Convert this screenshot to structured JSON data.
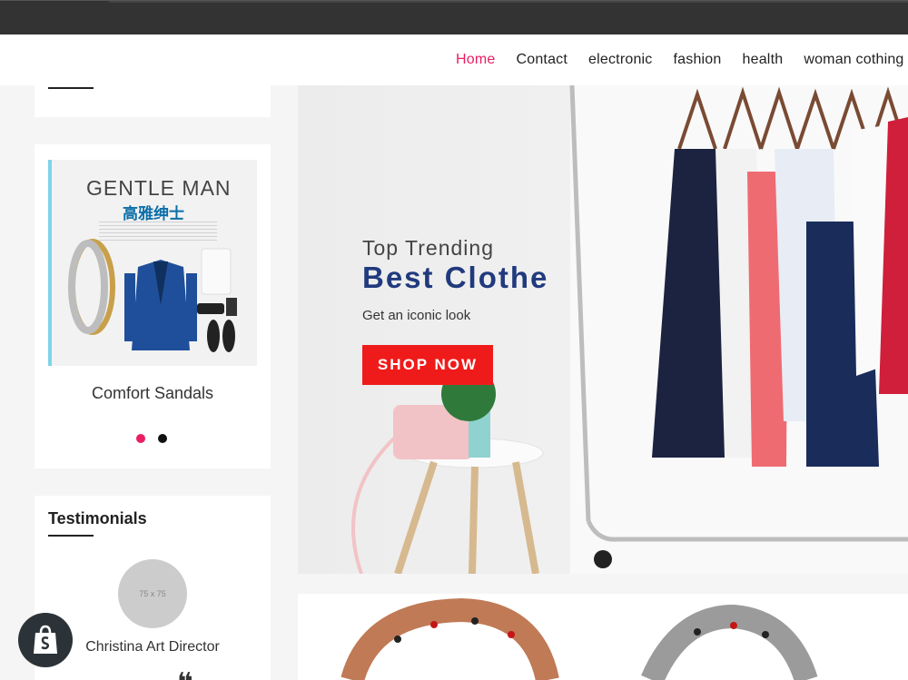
{
  "nav": {
    "items": [
      {
        "label": "Home",
        "active": true
      },
      {
        "label": "Contact",
        "active": false
      },
      {
        "label": "electronic",
        "active": false
      },
      {
        "label": "fashion",
        "active": false
      },
      {
        "label": "health",
        "active": false
      },
      {
        "label": "woman cothing",
        "active": false
      }
    ]
  },
  "product": {
    "image_title": "GENTLE MAN",
    "image_subtitle": "高雅绅士",
    "name": "Comfort Sandals",
    "slides": 2,
    "active_slide": 0
  },
  "testimonials": {
    "title": "Testimonials",
    "avatar_placeholder": "75 x 75",
    "name": "Christina Art Director"
  },
  "hero": {
    "subtitle": "Top Trending",
    "title": "Best Clothe",
    "description": "Get an iconic look",
    "button_label": "SHOP NOW"
  },
  "colors": {
    "accent": "#e91e63",
    "hero_title": "#213a7e",
    "button": "#ef1b1b",
    "topbar": "#333333"
  },
  "icons": [
    "shopify-bag-icon"
  ]
}
